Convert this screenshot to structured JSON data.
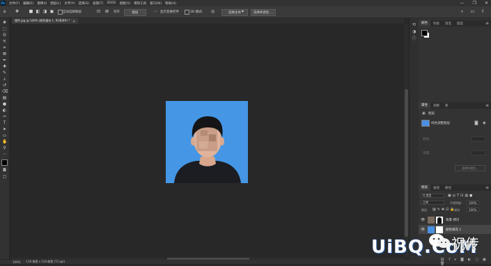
{
  "app": {
    "logo": "Ps",
    "window_controls": [
      "—",
      "❐",
      "✕"
    ]
  },
  "menu": [
    "文件(F)",
    "编辑(E)",
    "图像(I)",
    "图层(L)",
    "文字(Y)",
    "选择(S)",
    "滤镜(T)",
    "3D(D)",
    "视图(V)",
    "增效工具",
    "窗口(W)",
    "帮助(H)"
  ],
  "options": {
    "auto_select": "自动选择图层",
    "show_transform": "显示变换控件",
    "mode3d": "3D 模式:",
    "align_label": "对齐",
    "sample_all": "选择主体",
    "refine": "选择并遮住 ...",
    "dropdown": "图层"
  },
  "document": {
    "tab": "證件.jpg @ 100% (颜色填充 1, RGB/8#) *",
    "close": "×"
  },
  "status": {
    "zoom": "100%",
    "info": "118 像素 x 118 像素 (72 ppi)"
  },
  "tools": [
    "move-tool",
    "marquee-tool",
    "lasso-tool",
    "quick-select-tool",
    "crop-tool",
    "frame-tool",
    "eyedropper-tool",
    "healing-tool",
    "brush-tool",
    "stamp-tool",
    "history-brush-tool",
    "eraser-tool",
    "gradient-tool",
    "blur-tool",
    "dodge-tool",
    "pen-tool",
    "type-tool",
    "path-select-tool",
    "rectangle-tool",
    "hand-tool",
    "zoom-tool",
    "more-tools"
  ],
  "color_panel": {
    "tabs": [
      "颜色",
      "色板",
      "渐变",
      "图案"
    ],
    "active": 0
  },
  "properties_panel": {
    "tabs": [
      "属性",
      "调整",
      "库"
    ],
    "active": 0,
    "kind": "图层",
    "layer_name": "纯色调整图层",
    "row1": "羽化:",
    "row2": "浓度:",
    "button": "选择并遮住..."
  },
  "layers_panel": {
    "tabs": [
      "图层",
      "通道",
      "路径"
    ],
    "active": 0,
    "filter": "Q 类型",
    "blend_mode": "正常",
    "opacity_label": "不透明度:",
    "opacity": "100%",
    "lock_label": "锁定:",
    "fill_label": "填充:",
    "fill": "100%",
    "layers": [
      {
        "name": "背景 拷贝",
        "selected": false
      },
      {
        "name": "颜色填充 1",
        "selected": true
      }
    ]
  },
  "watermark": {
    "text": "UiBQ.CoM",
    "cn": "祝传"
  },
  "colors": {
    "photo_bg": "#4596e4",
    "fill_swatch": "#4a90e2"
  }
}
